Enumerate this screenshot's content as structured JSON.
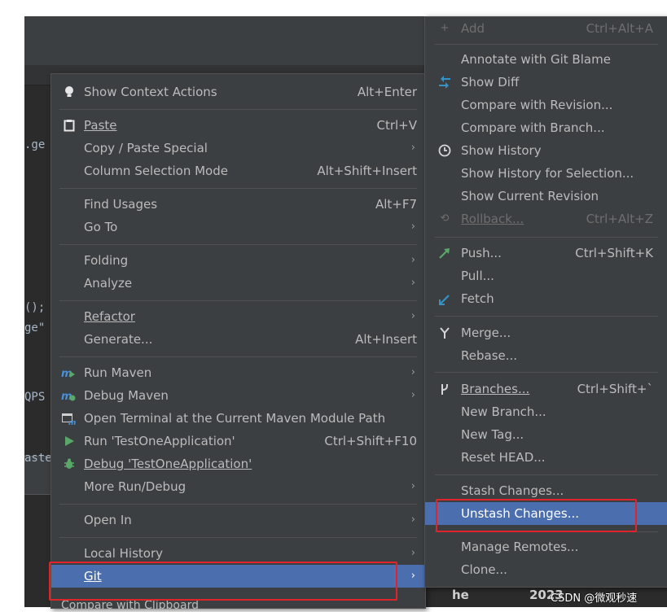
{
  "editor": {
    "code_fragments": [
      ".ge",
      "();",
      "ge\"",
      "QPS",
      "aste"
    ]
  },
  "context_menu": {
    "items": [
      {
        "label": "Show Context Actions",
        "shortcut": "Alt+Enter",
        "icon": "bulb-icon"
      },
      {
        "label": "Paste",
        "shortcut": "Ctrl+V",
        "icon": "clipboard-icon"
      },
      {
        "label": "Copy / Paste Special",
        "submenu": "›"
      },
      {
        "label": "Column Selection Mode",
        "shortcut": "Alt+Shift+Insert"
      },
      {
        "label": "Find Usages",
        "shortcut": "Alt+F7"
      },
      {
        "label": "Go To",
        "submenu": "›"
      },
      {
        "label": "Folding",
        "submenu": "›"
      },
      {
        "label": "Analyze",
        "submenu": "›"
      },
      {
        "label": "Refactor",
        "submenu": "›"
      },
      {
        "label": "Generate...",
        "shortcut": "Alt+Insert"
      },
      {
        "label": "Run Maven",
        "submenu": "›",
        "icon": "maven-run-icon"
      },
      {
        "label": "Debug Maven",
        "submenu": "›",
        "icon": "maven-debug-icon"
      },
      {
        "label": "Open Terminal at the Current Maven Module Path",
        "icon": "terminal-icon"
      },
      {
        "label": "Run 'TestOneApplication'",
        "shortcut": "Ctrl+Shift+F10",
        "icon": "run-icon"
      },
      {
        "label": "Debug 'TestOneApplication'",
        "icon": "debug-bug-icon"
      },
      {
        "label": "More Run/Debug",
        "submenu": "›"
      },
      {
        "label": "Open In",
        "submenu": "›"
      },
      {
        "label": "Local History",
        "submenu": "›"
      },
      {
        "label": "Git",
        "submenu": "›"
      },
      {
        "label": "Compare with Clipboard"
      }
    ]
  },
  "git_submenu": {
    "items": [
      {
        "label": "Add",
        "shortcut": "Ctrl+Alt+A",
        "icon": "plus-icon",
        "disabled": true
      },
      {
        "label": "Annotate with Git Blame"
      },
      {
        "label": "Show Diff",
        "icon": "diff-arrows-icon"
      },
      {
        "label": "Compare with Revision..."
      },
      {
        "label": "Compare with Branch..."
      },
      {
        "label": "Show History",
        "icon": "clock-icon"
      },
      {
        "label": "Show History for Selection..."
      },
      {
        "label": "Show Current Revision"
      },
      {
        "label": "Rollback...",
        "shortcut": "Ctrl+Alt+Z",
        "icon": "undo-icon",
        "disabled": true
      },
      {
        "label": "Push...",
        "shortcut": "Ctrl+Shift+K",
        "icon": "push-arrow-icon"
      },
      {
        "label": "Pull..."
      },
      {
        "label": "Fetch",
        "icon": "fetch-check-icon"
      },
      {
        "label": "Merge...",
        "icon": "merge-icon"
      },
      {
        "label": "Rebase..."
      },
      {
        "label": "Branches...",
        "shortcut": "Ctrl+Shift+`",
        "icon": "branch-icon"
      },
      {
        "label": "New Branch..."
      },
      {
        "label": "New Tag..."
      },
      {
        "label": "Reset HEAD..."
      },
      {
        "label": "Stash Changes..."
      },
      {
        "label": "Unstash Changes..."
      },
      {
        "label": "Manage Remotes..."
      },
      {
        "label": "Clone..."
      }
    ]
  },
  "footer": {
    "left_text": "he",
    "date_text": "2023",
    "watermark": "CSDN @微观秒速"
  },
  "colors": {
    "menu_bg": "#3c3f41",
    "selection": "#4b6eaf",
    "highlight_box": "#e0242c",
    "editor_bg": "#2b2b2b"
  }
}
